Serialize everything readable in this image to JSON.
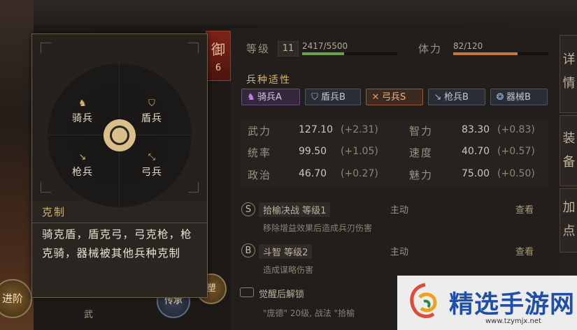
{
  "header": {
    "level_label": "等级",
    "level_value": "11",
    "exp_text": "2417/5500",
    "exp_fraction": 0.44,
    "stamina_label": "体力",
    "stamina_text": "82/120",
    "stamina_fraction": 0.68,
    "badge_char": "御",
    "badge_num": "6"
  },
  "aptitude": {
    "title": "兵种适性",
    "tags": [
      {
        "icon": "horse-icon",
        "label": "骑兵A",
        "color": "#b86ad6"
      },
      {
        "icon": "shield-icon",
        "label": "盾兵B",
        "color": "#7f95c9"
      },
      {
        "icon": "bow-icon",
        "label": "弓兵S",
        "color": "#e0824a"
      },
      {
        "icon": "spear-icon",
        "label": "枪兵B",
        "color": "#7f95c9"
      },
      {
        "icon": "machine-icon",
        "label": "器械B",
        "color": "#7f95c9"
      }
    ]
  },
  "stats": [
    {
      "label": "武力",
      "value": "127.10",
      "bonus": "(+2.31)"
    },
    {
      "label": "智力",
      "value": "83.30",
      "bonus": "(+0.83)"
    },
    {
      "label": "统率",
      "value": "99.50",
      "bonus": "(+1.05)"
    },
    {
      "label": "速度",
      "value": "40.70",
      "bonus": "(+0.57)"
    },
    {
      "label": "政治",
      "value": "46.70",
      "bonus": "(+0.27)"
    },
    {
      "label": "魅力",
      "value": "75.00",
      "bonus": "(+0.50)"
    }
  ],
  "skills": [
    {
      "grade": "S",
      "name": "拾榆决战 等级1",
      "type": "主动",
      "view": "查看",
      "desc": "移除增益效果后造成兵刃伤害"
    },
    {
      "grade": "B",
      "name": "斗智 等级2",
      "type": "主动",
      "view": "查看",
      "desc": "造成谋略伤害"
    }
  ],
  "awaken": {
    "title": "觉醒后解锁",
    "desc": "\"庞德\" 20级, 战法 \"拾榆"
  },
  "popup": {
    "units": {
      "cavalry": "骑兵",
      "shield": "盾兵",
      "spear": "枪兵",
      "bow": "弓兵"
    },
    "counter_title": "克制",
    "counter_text": "骑克盾，盾克弓，弓克枪，枪克骑，器械被其他兵种克制"
  },
  "right_tabs": [
    "详",
    "情",
    "装",
    "备",
    "加",
    "点"
  ],
  "bottom": {
    "btn_left": "进阶",
    "btn_mid_label": "武",
    "btn_right": "传承",
    "btn_right2": "塑"
  },
  "watermark": {
    "text": "精选手游网",
    "url": "www.tzymjx.net"
  }
}
